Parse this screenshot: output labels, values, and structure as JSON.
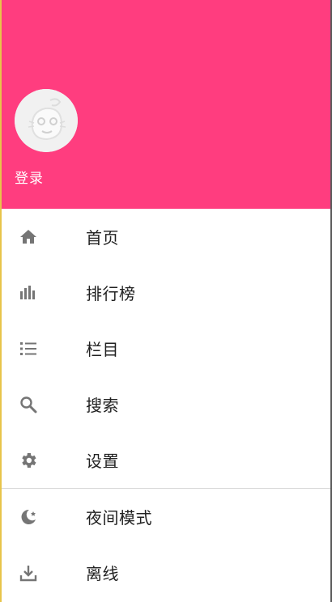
{
  "colors": {
    "header_bg": "#ff3d7f",
    "icon": "#757575",
    "text": "#212121"
  },
  "header": {
    "login_label": "登录"
  },
  "menu": {
    "primary": [
      {
        "label": "首页",
        "icon": "home-icon"
      },
      {
        "label": "排行榜",
        "icon": "bar-chart-icon"
      },
      {
        "label": "栏目",
        "icon": "list-icon"
      },
      {
        "label": "搜索",
        "icon": "search-icon"
      },
      {
        "label": "设置",
        "icon": "gear-icon"
      }
    ],
    "secondary": [
      {
        "label": "夜间模式",
        "icon": "moon-icon"
      },
      {
        "label": "离线",
        "icon": "download-icon"
      }
    ]
  }
}
